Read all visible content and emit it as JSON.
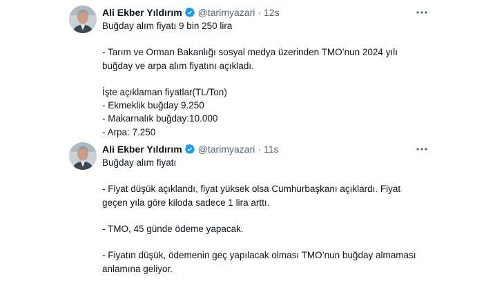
{
  "tweets": [
    {
      "author_name": "Ali Ekber Yıldırım",
      "handle": "@tarimyazari",
      "separator": "·",
      "time": "12s",
      "more_label": "⋯",
      "lines": [
        "Buğday alım fiyatı 9 bin 250 lira",
        "",
        "- Tarım ve Orman Bakanlığı sosyal medya üzerinden TMO’nun 2024 yılı",
        "buğday ve arpa  alım fiyatını açıkladı.",
        "",
        "İşte açıklaman fiyatlar(TL/Ton)",
        "- Ekmeklik buğday 9.250",
        "- Makarnalık buğday:10.000",
        "- Arpa: 7.250"
      ]
    },
    {
      "author_name": "Ali Ekber Yıldırım",
      "handle": "@tarimyazari",
      "separator": "·",
      "time": "11s",
      "more_label": "⋯",
      "lines": [
        "Buğday alım fiyatı",
        "",
        "- Fiyat düşük açıklandı, fiyat yüksek olsa Cumhurbaşkanı açıklardı. Fiyat",
        "geçen yıla göre kiloda sadece 1 lira arttı.",
        "",
        "- TMO, 45 günde ödeme yapacak.",
        "",
        "- Fiyatın düşük, ödemenin geç yapılacak olması TMO’nun buğday almaması",
        "anlamına geliyor."
      ]
    }
  ],
  "colors": {
    "verified": "#1d9bf0",
    "secondary_text": "#536471",
    "primary_text": "#0f1419"
  },
  "icons": {
    "verified": "verified-badge-icon",
    "more": "more-options-icon"
  }
}
